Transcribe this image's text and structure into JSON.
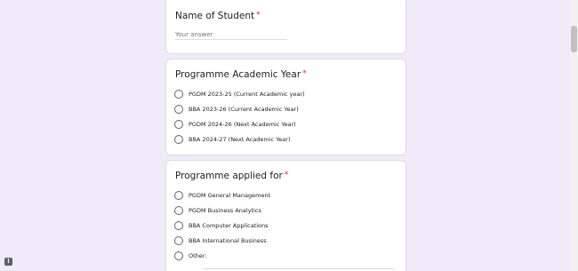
{
  "questions": [
    {
      "title": "Name of Student",
      "required_mark": "*",
      "placeholder": "Your answer"
    },
    {
      "title": "Programme Academic Year",
      "required_mark": "*",
      "options": [
        "PGDM 2023-25 (Current Academic year)",
        "BBA 2023-26 (Current Academic Year)",
        "PGDM 2024-26 (Next Academic Year)",
        "BBA 2024-27 (Next Academic Year)"
      ]
    },
    {
      "title": "Programme applied for",
      "required_mark": "*",
      "options": [
        "PGDM General Management",
        "PGDM Business Analytics",
        "BBA Computer Applications",
        "BBA International Business",
        "Other:"
      ]
    }
  ],
  "feedback_icon": "report-problem-icon",
  "feedback_glyph": "!"
}
